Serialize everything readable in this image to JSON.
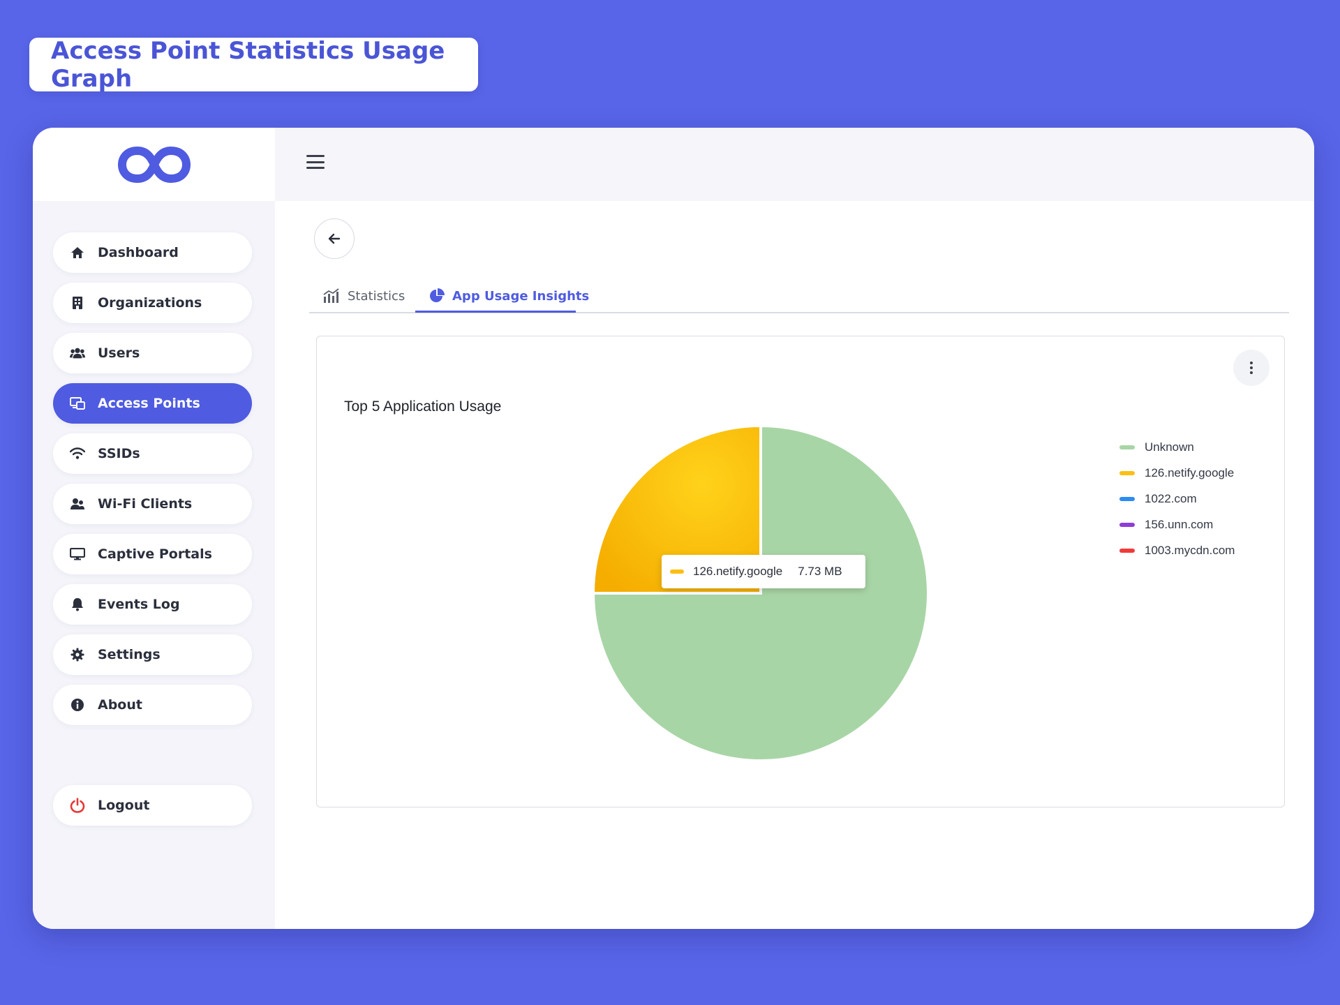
{
  "banner": {
    "title": "Access Point Statistics Usage Graph"
  },
  "sidebar": {
    "items": [
      {
        "label": "Dashboard",
        "icon": "home-icon"
      },
      {
        "label": "Organizations",
        "icon": "building-icon"
      },
      {
        "label": "Users",
        "icon": "users-icon"
      },
      {
        "label": "Access Points",
        "icon": "access-point-icon",
        "active": true
      },
      {
        "label": "SSIDs",
        "icon": "wifi-icon"
      },
      {
        "label": "Wi-Fi Clients",
        "icon": "clients-icon"
      },
      {
        "label": "Captive Portals",
        "icon": "monitor-icon"
      },
      {
        "label": "Events Log",
        "icon": "bell-icon"
      },
      {
        "label": "Settings",
        "icon": "gear-icon"
      },
      {
        "label": "About",
        "icon": "info-icon"
      }
    ],
    "logout": {
      "label": "Logout",
      "icon": "power-icon"
    }
  },
  "tabs": [
    {
      "label": "Statistics",
      "icon": "bar-chart-icon"
    },
    {
      "label": "App Usage Insights",
      "icon": "pie-chart-icon",
      "active": true
    }
  ],
  "chart_data": {
    "type": "pie",
    "title": "Top 5 Application Usage",
    "series": [
      {
        "name": "Unknown",
        "share": 0.75,
        "color": "#a8d5a6"
      },
      {
        "name": "126.netify.google",
        "value": 7.73,
        "unit": "MB",
        "share": 0.25,
        "color": "#fbbf14"
      },
      {
        "name": "1022.com",
        "share": 0,
        "color": "#2d8cf0"
      },
      {
        "name": "156.unn.com",
        "share": 0,
        "color": "#8e3cd6"
      },
      {
        "name": "1003.mycdn.com",
        "share": 0,
        "color": "#f03a3a"
      }
    ],
    "legend_position": "right",
    "tooltip": {
      "label": "126.netify.google",
      "value": "7.73 MB",
      "color": "#fbbf14"
    }
  },
  "colors": {
    "accent": "#4f5be0",
    "background": "#5865e8",
    "logout": "#e53935"
  }
}
